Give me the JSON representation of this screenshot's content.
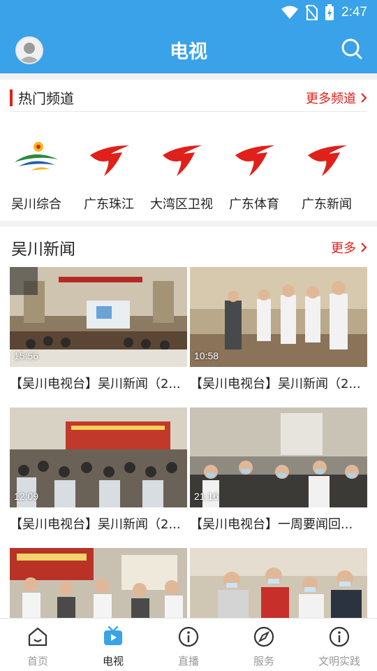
{
  "status_bar": {
    "time": "2:47"
  },
  "header": {
    "title": "电视"
  },
  "channels": {
    "title": "热门频道",
    "more": "更多频道",
    "items": [
      {
        "label": "吴川综合",
        "icon": "wuchuan-logo-icon"
      },
      {
        "label": "广东珠江",
        "icon": "gdtv-logo-icon"
      },
      {
        "label": "大湾区卫视",
        "icon": "gdtv-logo-icon"
      },
      {
        "label": "广东体育",
        "icon": "gdtv-logo-icon"
      },
      {
        "label": "广东新闻",
        "icon": "gdtv-logo-icon"
      }
    ]
  },
  "news": {
    "title": "吴川新闻",
    "more": "更多",
    "items": [
      {
        "duration": "15:56",
        "caption": "【吴川电视台】吴川新闻（2..."
      },
      {
        "duration": "10:58",
        "caption": "【吴川电视台】吴川新闻（2..."
      },
      {
        "duration": "12:09",
        "caption": "【吴川电视台】吴川新闻（2..."
      },
      {
        "duration": "21:16",
        "caption": "【吴川电视台】一周要闻回..."
      },
      {
        "duration": "",
        "caption": ""
      },
      {
        "duration": "",
        "caption": ""
      }
    ]
  },
  "tabbar": {
    "items": [
      {
        "label": "首页",
        "icon": "home-icon"
      },
      {
        "label": "电视",
        "icon": "tv-icon"
      },
      {
        "label": "直播",
        "icon": "info-icon"
      },
      {
        "label": "服务",
        "icon": "compass-icon"
      },
      {
        "label": "文明实践",
        "icon": "info-icon"
      }
    ],
    "active_index": 1
  },
  "colors": {
    "primary": "#39a2e8",
    "accent": "#e0201a"
  }
}
